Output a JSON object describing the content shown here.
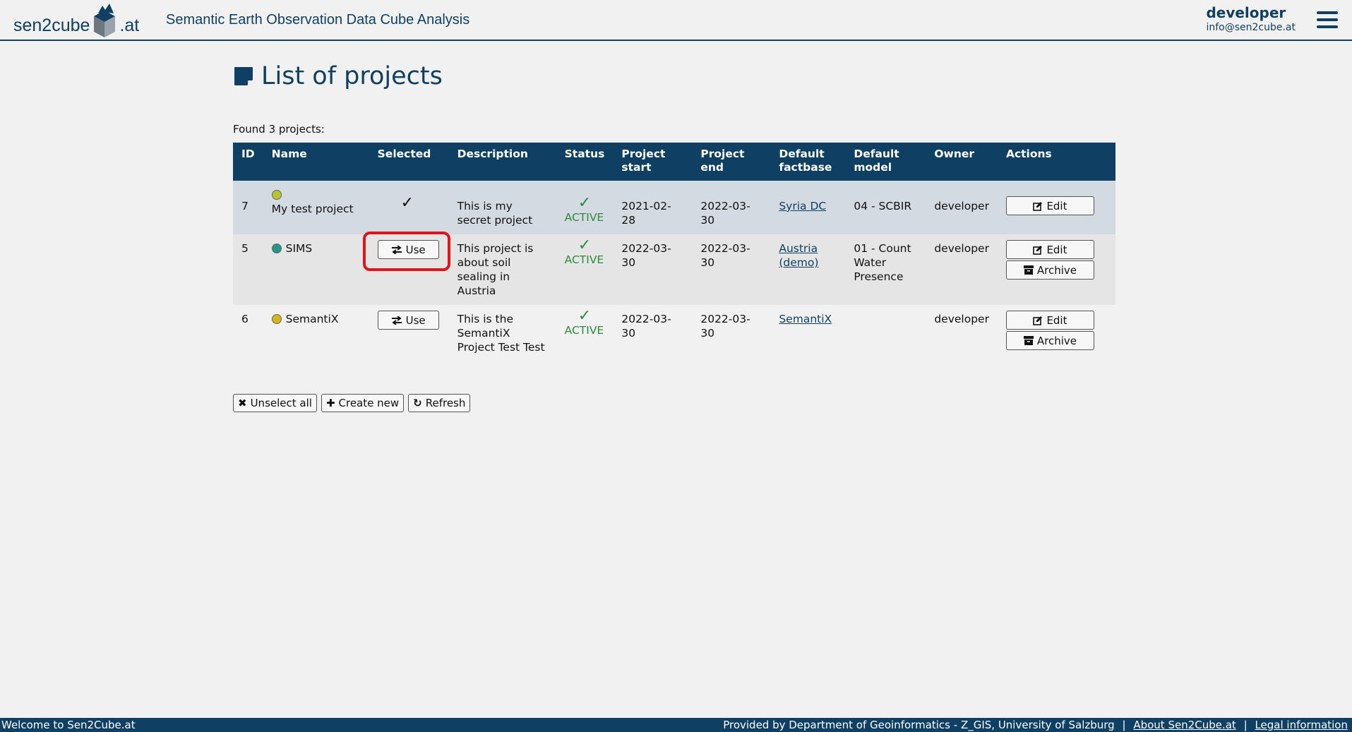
{
  "header": {
    "logo_text_left": "sen2cube",
    "logo_text_right": ".at",
    "app_title": "Semantic Earth Observation Data Cube Analysis",
    "user_name": "developer",
    "user_email": "info@sen2cube.at"
  },
  "page": {
    "title": "List of projects",
    "found_text": "Found 3 projects:"
  },
  "table": {
    "headers": {
      "id": "ID",
      "name": "Name",
      "selected": "Selected",
      "description": "Description",
      "status": "Status",
      "project_start": "Project start",
      "project_end": "Project end",
      "default_factbase": "Default factbase",
      "default_model": "Default model",
      "owner": "Owner",
      "actions": "Actions"
    },
    "rows": [
      {
        "id": "7",
        "name": "My test project",
        "dot_color": "#b7c52f",
        "selected_mark": "✓",
        "description": "This is my secret project",
        "status_mark": "✓",
        "status": "ACTIVE",
        "start": "2021-02-28",
        "end": "2022-03-30",
        "factbase": "Syria DC",
        "model": "04 - SCBIR",
        "owner": "developer",
        "edit_label": "Edit"
      },
      {
        "id": "5",
        "name": "SIMS",
        "dot_color": "#22968f",
        "use_label": "Use",
        "description": "This project is about soil sealing in Austria",
        "status_mark": "✓",
        "status": "ACTIVE",
        "start": "2022-03-30",
        "end": "2022-03-30",
        "factbase": "Austria (demo)",
        "model": "01 - Count Water Presence",
        "owner": "developer",
        "edit_label": "Edit",
        "archive_label": "Archive"
      },
      {
        "id": "6",
        "name": "SemantiX",
        "dot_color": "#d9b318",
        "use_label": "Use",
        "description": "This is the SemantiX Project Test Test",
        "status_mark": "✓",
        "status": "ACTIVE",
        "start": "2022-03-30",
        "end": "2022-03-30",
        "factbase": "SemantiX",
        "model": "",
        "owner": "developer",
        "edit_label": "Edit",
        "archive_label": "Archive"
      }
    ]
  },
  "buttons": {
    "unselect_all": "Unselect all",
    "create_new": "Create new",
    "refresh": "Refresh"
  },
  "footer": {
    "welcome": "Welcome to Sen2Cube.at",
    "provided_by": "Provided by Department of Geoinformatics - Z_GIS, University of Salzburg",
    "about": "About Sen2Cube.at",
    "legal": "Legal information",
    "separator": "|"
  },
  "colors": {
    "brand": "#0f3f62",
    "active_green": "#2e8b3d",
    "highlight_red": "#e1141c"
  }
}
